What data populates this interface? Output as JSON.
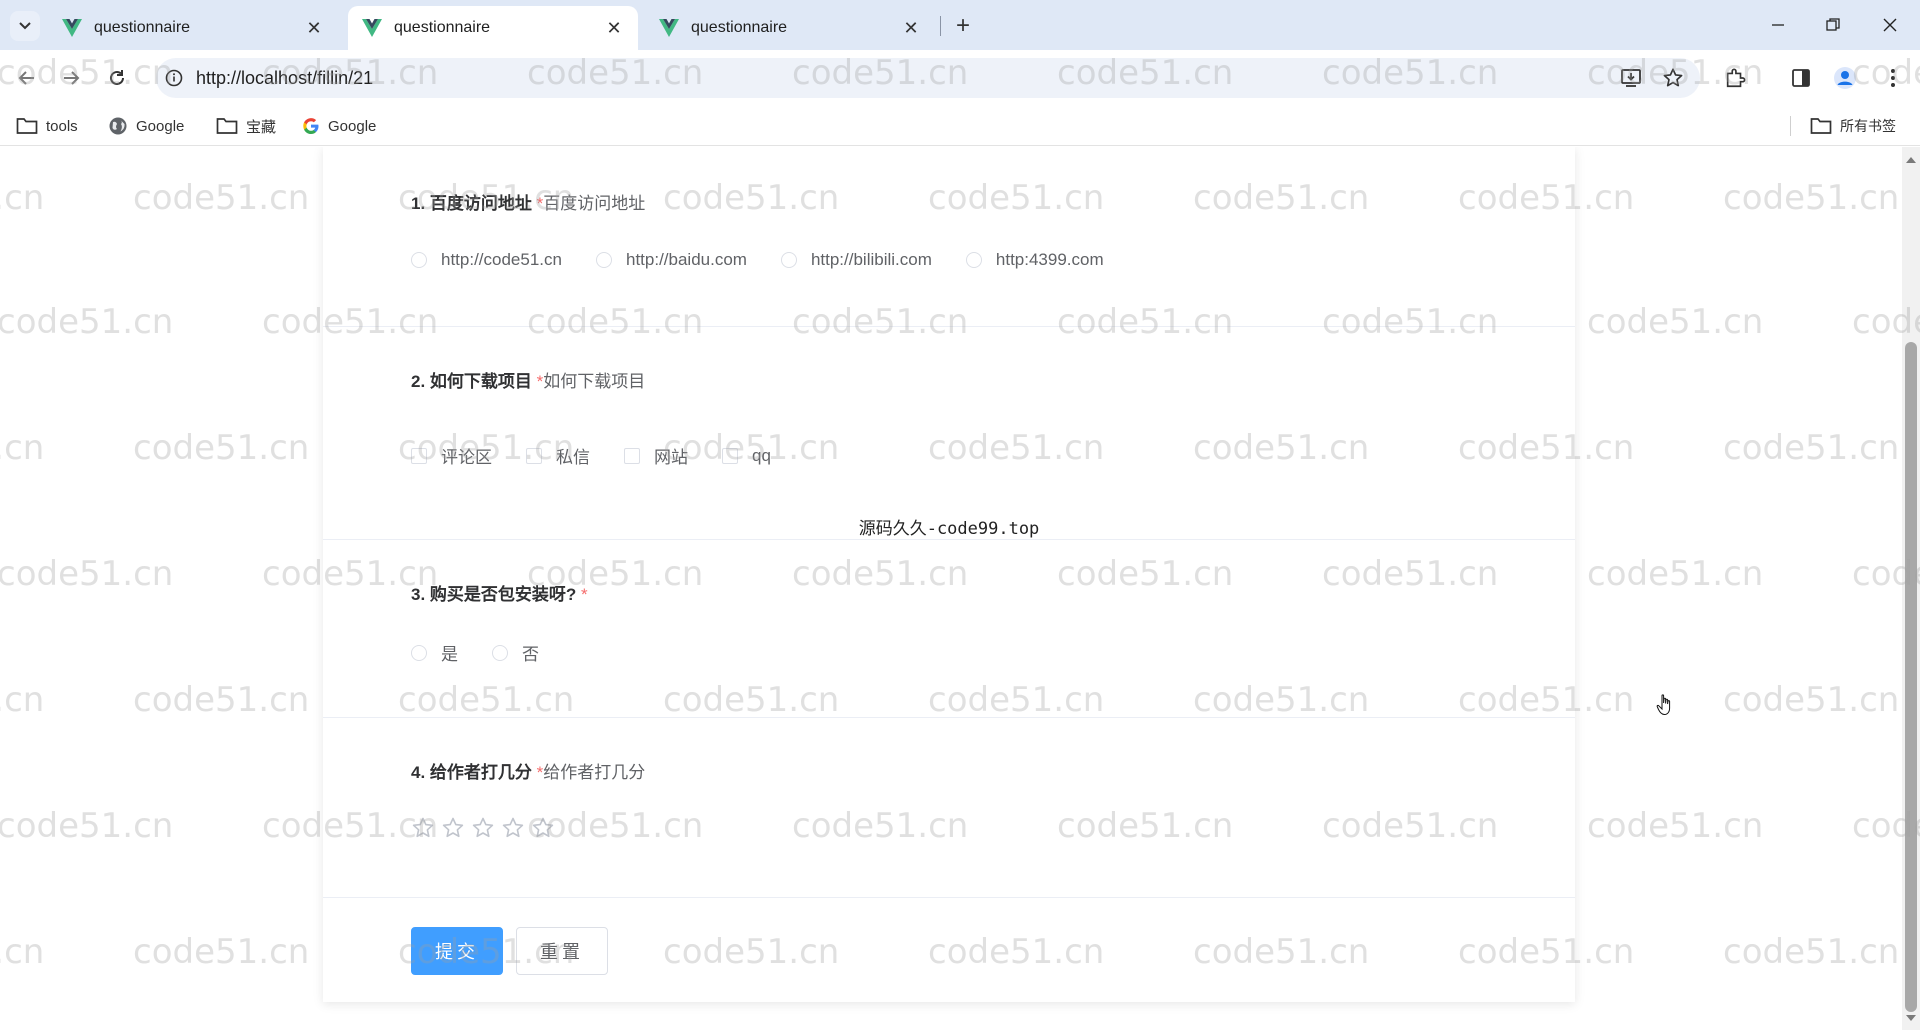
{
  "browser": {
    "tabs": [
      {
        "title": "questionnaire"
      },
      {
        "title": "questionnaire"
      },
      {
        "title": "questionnaire"
      }
    ],
    "url": "http://localhost/fillin/21",
    "bookmarks": [
      {
        "label": "tools",
        "icon": "folder-icon"
      },
      {
        "label": "Google",
        "icon": "globe-icon"
      },
      {
        "label": "宝藏",
        "icon": "folder-icon"
      },
      {
        "label": "Google",
        "icon": "google-g-icon"
      }
    ],
    "all_bookmarks_label": "所有书签"
  },
  "form": {
    "questions": [
      {
        "number": "1.",
        "title": "百度访问地址",
        "required_mark": "*",
        "description": "百度访问地址",
        "type": "radio",
        "options": [
          "http://code51.cn",
          "http://baidu.com",
          "http://bilibili.com",
          "http:4399.com"
        ]
      },
      {
        "number": "2.",
        "title": "如何下载项目",
        "required_mark": "*",
        "description": "如何下载项目",
        "type": "checkbox",
        "options": [
          "评论区",
          "私信",
          "网站",
          "qq"
        ]
      },
      {
        "number": "3.",
        "title": "购买是否包安装呀?",
        "required_mark": "*",
        "description": "",
        "type": "radio",
        "options": [
          "是",
          "否"
        ]
      },
      {
        "number": "4.",
        "title": "给作者打几分",
        "required_mark": "*",
        "description": "给作者打几分",
        "type": "rate",
        "max_stars": 5,
        "value": 0
      }
    ],
    "center_note": "源码久久-code99.top",
    "submit_label": "提交",
    "reset_label": "重置"
  },
  "watermark_text": "code51.cn",
  "colors": {
    "primary": "#409eff",
    "required": "#f56c6c",
    "tabstrip": "#dfe8f6"
  }
}
